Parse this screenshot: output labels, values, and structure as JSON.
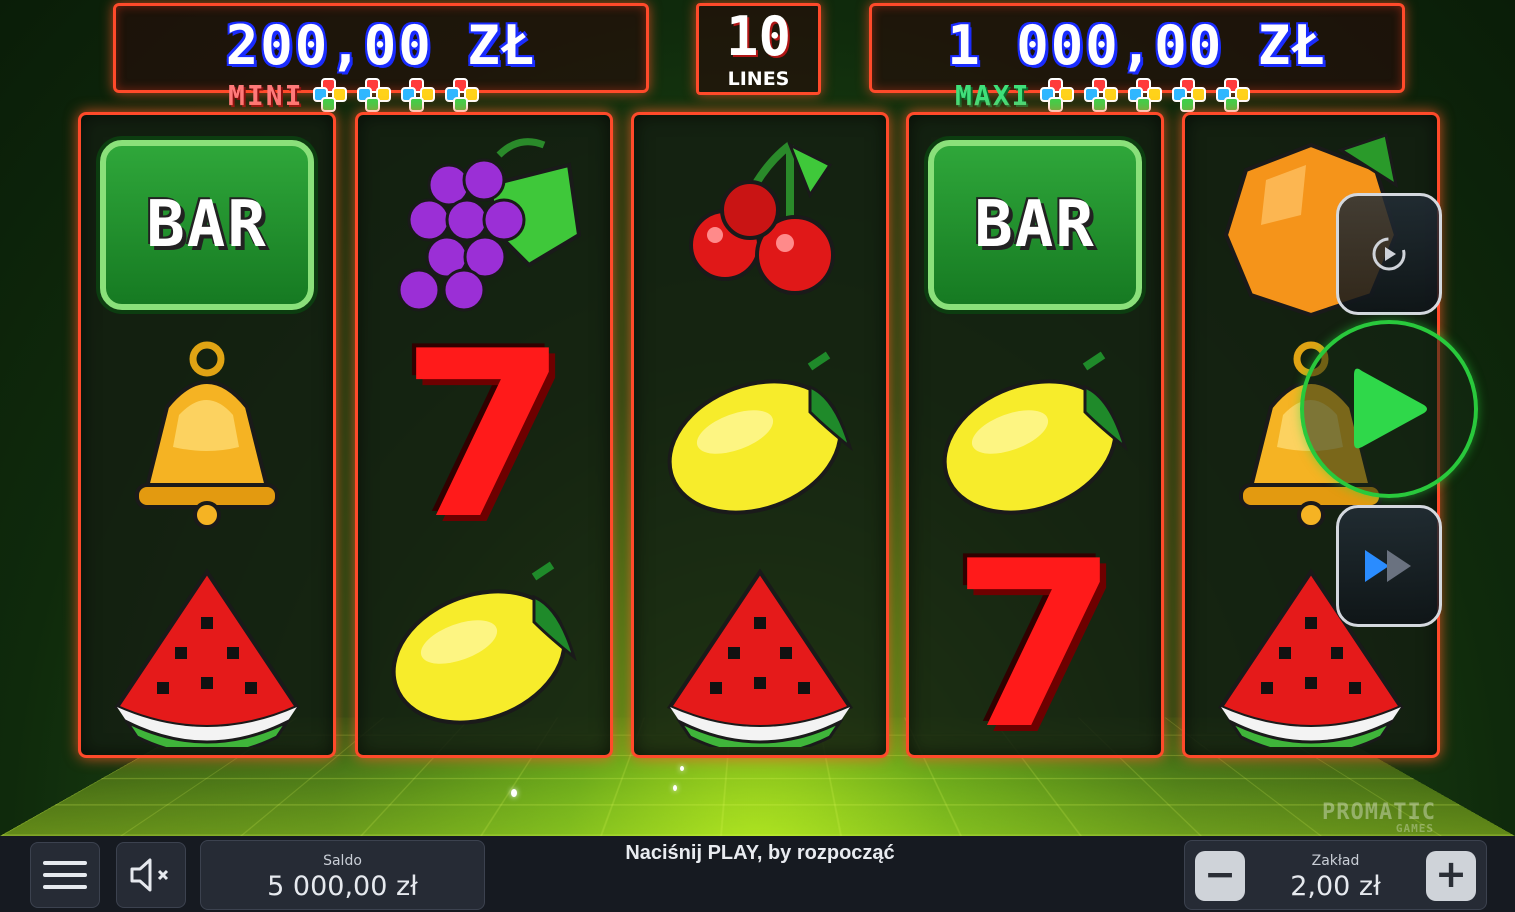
{
  "jackpots": {
    "mini": {
      "amount": "200,00 ZŁ",
      "label": "MINI",
      "clovers": 4
    },
    "maxi": {
      "amount": "1 000,00 ZŁ",
      "label": "MAXI",
      "clovers": 5
    }
  },
  "lines": {
    "count": "10",
    "label": "LINES"
  },
  "reels": [
    [
      "bar",
      "bell",
      "watermelon"
    ],
    [
      "grapes",
      "seven",
      "lemon"
    ],
    [
      "cherries",
      "lemon",
      "watermelon"
    ],
    [
      "bar",
      "lemon",
      "seven"
    ],
    [
      "orange",
      "bell",
      "watermelon"
    ]
  ],
  "symbols": {
    "bar_text": "BAR",
    "seven_text": "7"
  },
  "controls": {
    "autoplay_icon": "autoplay-icon",
    "play_icon": "play-icon",
    "turbo_icon": "fast-forward-icon",
    "menu_icon": "hamburger-menu-icon",
    "sound_icon": "speaker-muted-icon"
  },
  "bottom_bar": {
    "balance_label": "Saldo",
    "balance_value": "5 000,00 zł",
    "message": "Naciśnij PLAY, by rozpocząć",
    "bet_label": "Zakład",
    "bet_value": "2,00 zł",
    "minus": "−",
    "plus": "+"
  },
  "brand": {
    "name": "PROMATIC",
    "sub": "GAMES"
  },
  "colors": {
    "frame": "#ff4a2a",
    "play": "#29c93c",
    "bottom": "#161a21"
  }
}
